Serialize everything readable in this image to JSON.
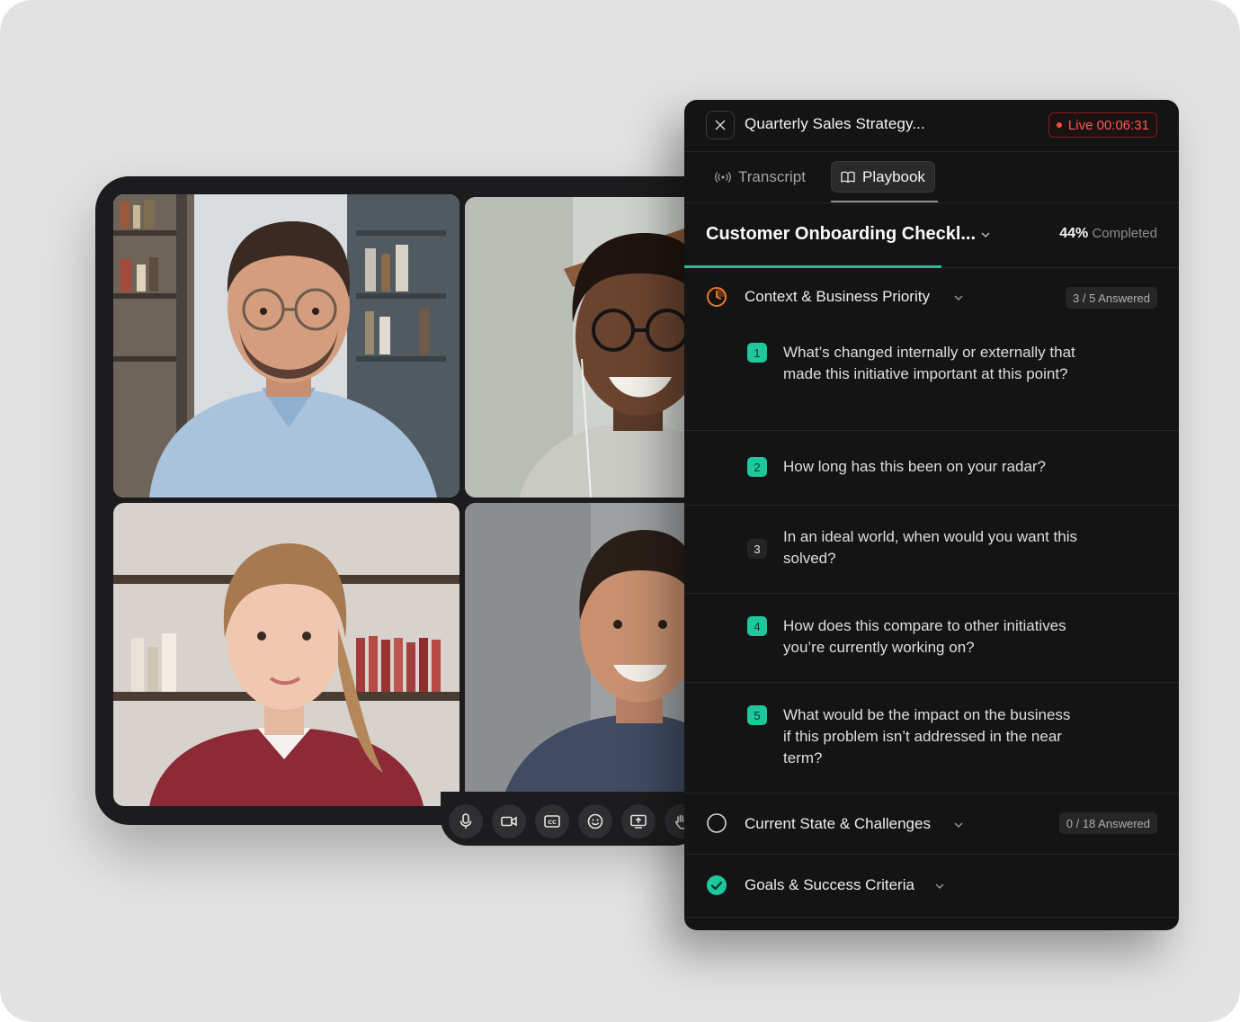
{
  "meeting": {
    "title": "Quarterly Sales Strategy...",
    "live_label": "Live 00:06:31"
  },
  "tabs": [
    {
      "label": "Transcript",
      "icon": "broadcast-icon",
      "active": false
    },
    {
      "label": "Playbook",
      "icon": "book-icon",
      "active": true
    }
  ],
  "checklist": {
    "title": "Customer Onboarding Checkl...",
    "percent_label": "44%",
    "completed_label": "Completed",
    "progress_fraction": 0.52
  },
  "sections": [
    {
      "title": "Context & Business Priority",
      "answered": "3 / 5 Answered",
      "status": "in-progress",
      "questions": [
        {
          "num": "1",
          "text": "What’s changed internally or externally that made this initiative important at this point?",
          "answered": true
        },
        {
          "num": "2",
          "text": "How long has this been on your radar?",
          "answered": true
        },
        {
          "num": "3",
          "text": "In an ideal world, when would you want this solved?",
          "answered": false
        },
        {
          "num": "4",
          "text": "How does this compare to other initiatives you’re currently working on?",
          "answered": true
        },
        {
          "num": "5",
          "text": "What would be the impact on the business if this problem isn’t addressed in the near term?",
          "answered": true
        }
      ]
    },
    {
      "title": "Current State & Challenges",
      "answered": "0 / 18 Answered",
      "status": "not-started"
    },
    {
      "title": "Goals & Success Criteria",
      "status": "complete"
    }
  ],
  "call_controls": [
    "microphone-icon",
    "camera-icon",
    "captions-icon",
    "emoji-icon",
    "share-screen-icon",
    "raise-hand-icon"
  ],
  "colors": {
    "accent": "#1fc79c",
    "live": "#ff5a57",
    "in_progress": "#e8792b",
    "panel_bg": "#141414"
  }
}
